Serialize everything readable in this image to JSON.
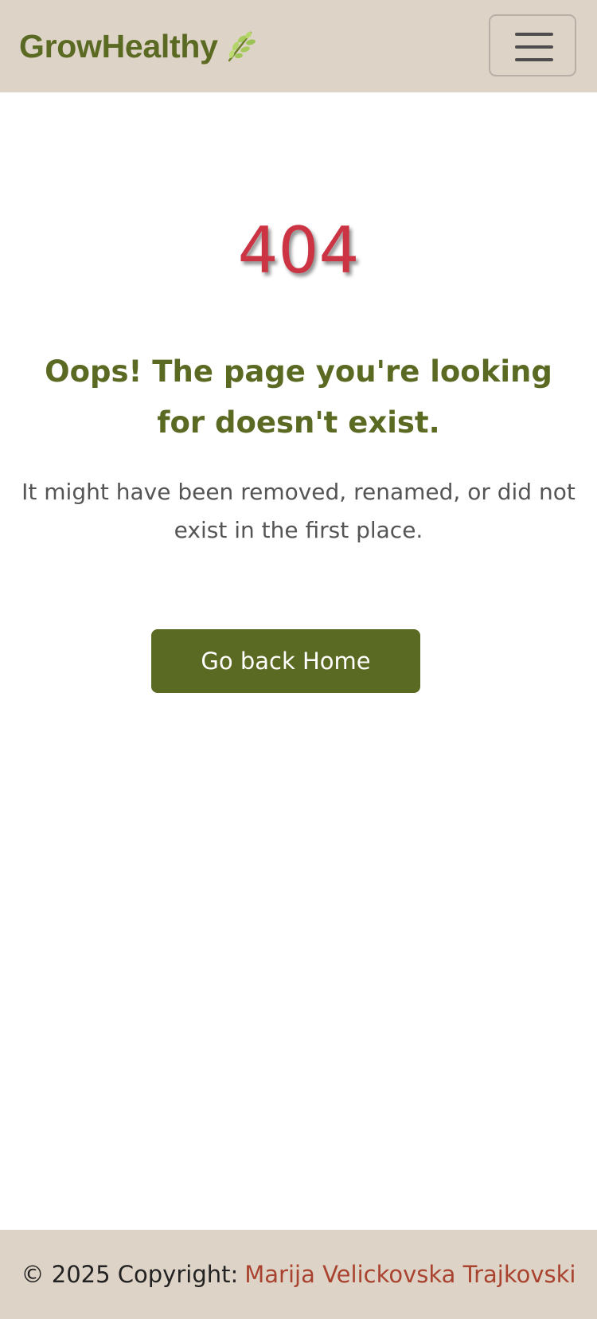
{
  "navbar": {
    "brand": "GrowHealthy",
    "brand_icon": "leaf-icon",
    "menu_icon": "hamburger-menu-icon"
  },
  "error": {
    "code": "404",
    "headline": "Oops! The page you're looking for doesn't exist.",
    "message": "It might have been removed, renamed, or did not exist in the first place.",
    "button_label": "Go back Home"
  },
  "footer": {
    "copyright": "© 2025 Copyright:",
    "author": "Marija Velickovska Trajkovski"
  },
  "colors": {
    "navbar_bg": "#ded3c7",
    "brand": "#5b6a22",
    "error_code": "#cc3343",
    "button_bg": "#5b6a22",
    "footer_link": "#a9432f"
  }
}
